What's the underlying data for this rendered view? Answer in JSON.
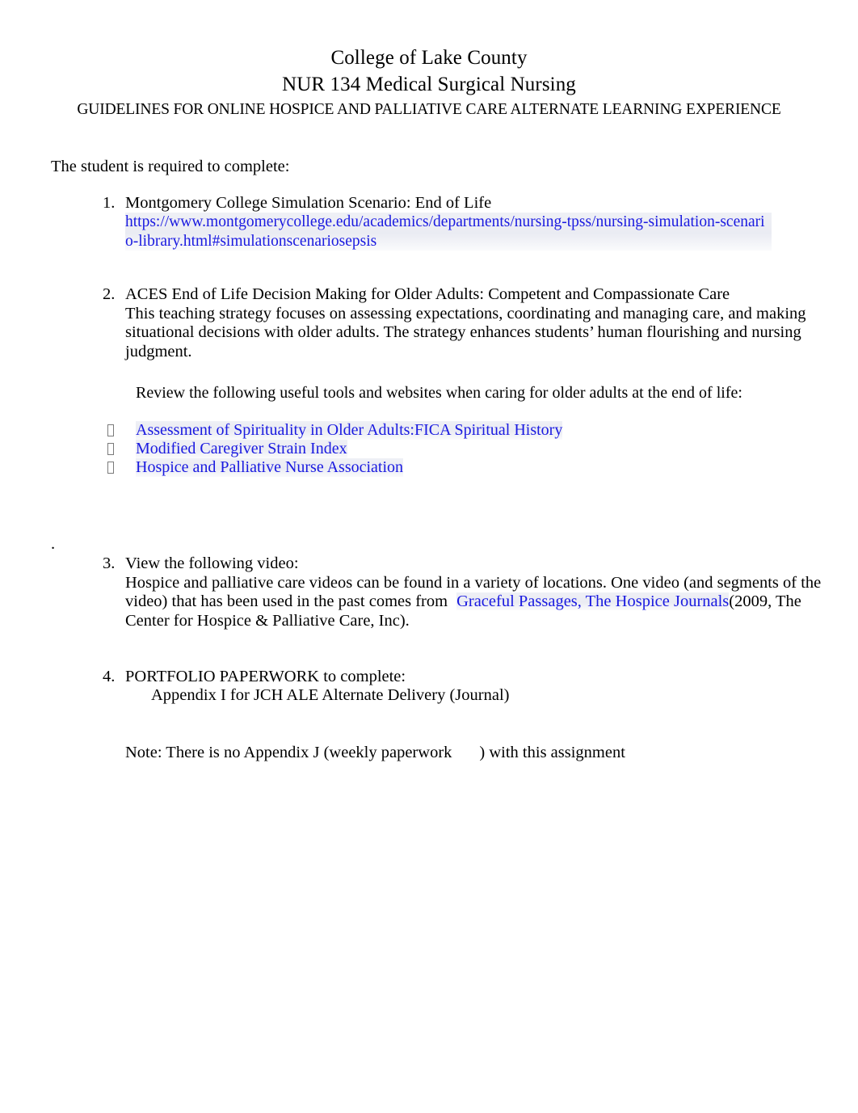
{
  "document": {
    "header": {
      "institution": "College of Lake County",
      "course": "NUR 134 Medical Surgical Nursing",
      "subtitle": "GUIDELINES FOR ONLINE HOSPICE AND PALLIATIVE CARE ALTERNATE LEARNING EXPERIENCE"
    },
    "intro": "The student is required to complete:",
    "stray_period": ".",
    "items": [
      {
        "number": "1.",
        "heading": "Montgomery College Simulation Scenario: End of Life",
        "url": "https://www.montgomerycollege.edu/academics/departments/nursing-tpss/nursing-simulation-scenario-library.html#simulationscenariosepsis"
      },
      {
        "number": "2.",
        "heading": "ACES End of Life Decision Making for Older Adults: Competent and Compassionate Care",
        "paragraph": "This teaching strategy focuses on assessing expectations, coordinating and managing care, and making situational decisions with older adults. The strategy enhances students’ human flourishing and nursing judgment.",
        "review_line": "Review the following useful tools and websites when caring for older adults at the end of life:",
        "links": [
          "Assessment of Spirituality in Older Adults:FICA Spiritual History",
          "Modified Caregiver Strain Index",
          "Hospice and Palliative Nurse Association"
        ]
      },
      {
        "number": "3.",
        "heading": "View the following video:",
        "paragraph_before": "Hospice and palliative care videos can be found in a variety of locations. One video (and segments of the video) that has been used in the past comes from",
        "link_text": "Graceful Passages, The Hospice Journals",
        "paragraph_after": "(2009, The Center for Hospice & Palliative Care, Inc)."
      },
      {
        "number": "4.",
        "heading": "PORTFOLIO PAPERWORK to complete:",
        "appendix": "Appendix I for JCH ALE Alternate Delivery (Journal)"
      }
    ],
    "note": {
      "before_gap": "Note: There is no Appendix J (weekly paperwork",
      "after_gap": ") with this assignment"
    },
    "colors": {
      "hyperlink": "#1a1ae0",
      "text": "#000000",
      "highlight": "#e5e7f0",
      "bullet_marker": "#7a7a7a"
    }
  }
}
